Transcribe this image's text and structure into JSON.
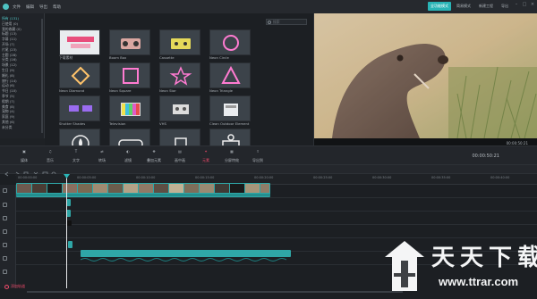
{
  "menubar": {
    "items": [
      "文件",
      "编辑",
      "导出",
      "帮助"
    ],
    "modes": [
      "全功能模式",
      "简易模式",
      "新建工程",
      "导出"
    ],
    "active_mode": "全功能模式"
  },
  "categories": [
    "所有 (131)",
    "已使用 (0)",
    "我的收藏 (0)",
    "标题 (13)",
    "字幕 (11)",
    "开场 (7)",
    "片尾 (23)",
    "主题 (28)",
    "分类 (16)",
    "场景 (12)",
    "生日 (9)",
    "婚礼 (8)",
    "旅行 (14)",
    "运动 (6)",
    "节日 (10)",
    "季节 (5)",
    "假期 (7)",
    "美食 (8)",
    "宠物 (4)",
    "家庭 (9)",
    "其他 (6)",
    "未分类"
  ],
  "search": {
    "placeholder": "搜索"
  },
  "elements": [
    {
      "label": "下载素材",
      "thumb": "pink-sticker"
    },
    {
      "label": "Boom Box",
      "thumb": "boombox"
    },
    {
      "label": "Cassette",
      "thumb": "cassette"
    },
    {
      "label": "Neon Circle",
      "thumb": "neon-circle"
    },
    {
      "label": "Neon Diamond",
      "thumb": "neon-diamond"
    },
    {
      "label": "Neon Square",
      "thumb": "neon-square"
    },
    {
      "label": "Neon Star",
      "thumb": "neon-star"
    },
    {
      "label": "Neon Triangle",
      "thumb": "neon-triangle"
    },
    {
      "label": "Shutter Shades",
      "thumb": "shades"
    },
    {
      "label": "Television",
      "thumb": "tv"
    },
    {
      "label": "VHS",
      "thumb": "vhs"
    },
    {
      "label": "Clean Outdoor Element",
      "thumb": "outdoor"
    },
    {
      "label": "",
      "thumb": "fire"
    },
    {
      "label": "",
      "thumb": "goggles"
    },
    {
      "label": "",
      "thumb": "cup"
    },
    {
      "label": "",
      "thumb": "basket"
    }
  ],
  "preview": {
    "time": "00:00:50:21"
  },
  "toolbar": {
    "items": [
      "媒体",
      "音乐",
      "文字",
      "转场",
      "滤镜",
      "叠加元素",
      "画中画",
      "元素",
      "分屏特效",
      "导出到"
    ],
    "active": "元素",
    "timecode": "00:00:50:21"
  },
  "ruler": {
    "ticks": [
      "00:00:00:00",
      "00:00:05:00",
      "00:00:10:00",
      "00:00:15:00",
      "00:00:20:00",
      "00:00:25:00",
      "00:00:30:00",
      "00:00:35:00",
      "00:00:40:00"
    ]
  },
  "timeline": {
    "record_label": "添加轨道"
  },
  "watermark": {
    "chars": "天天下载",
    "url": "www.ttrar.com"
  },
  "colors": {
    "accent": "#29b4b6",
    "active": "#ef4a6a",
    "bg": "#1e2125"
  }
}
